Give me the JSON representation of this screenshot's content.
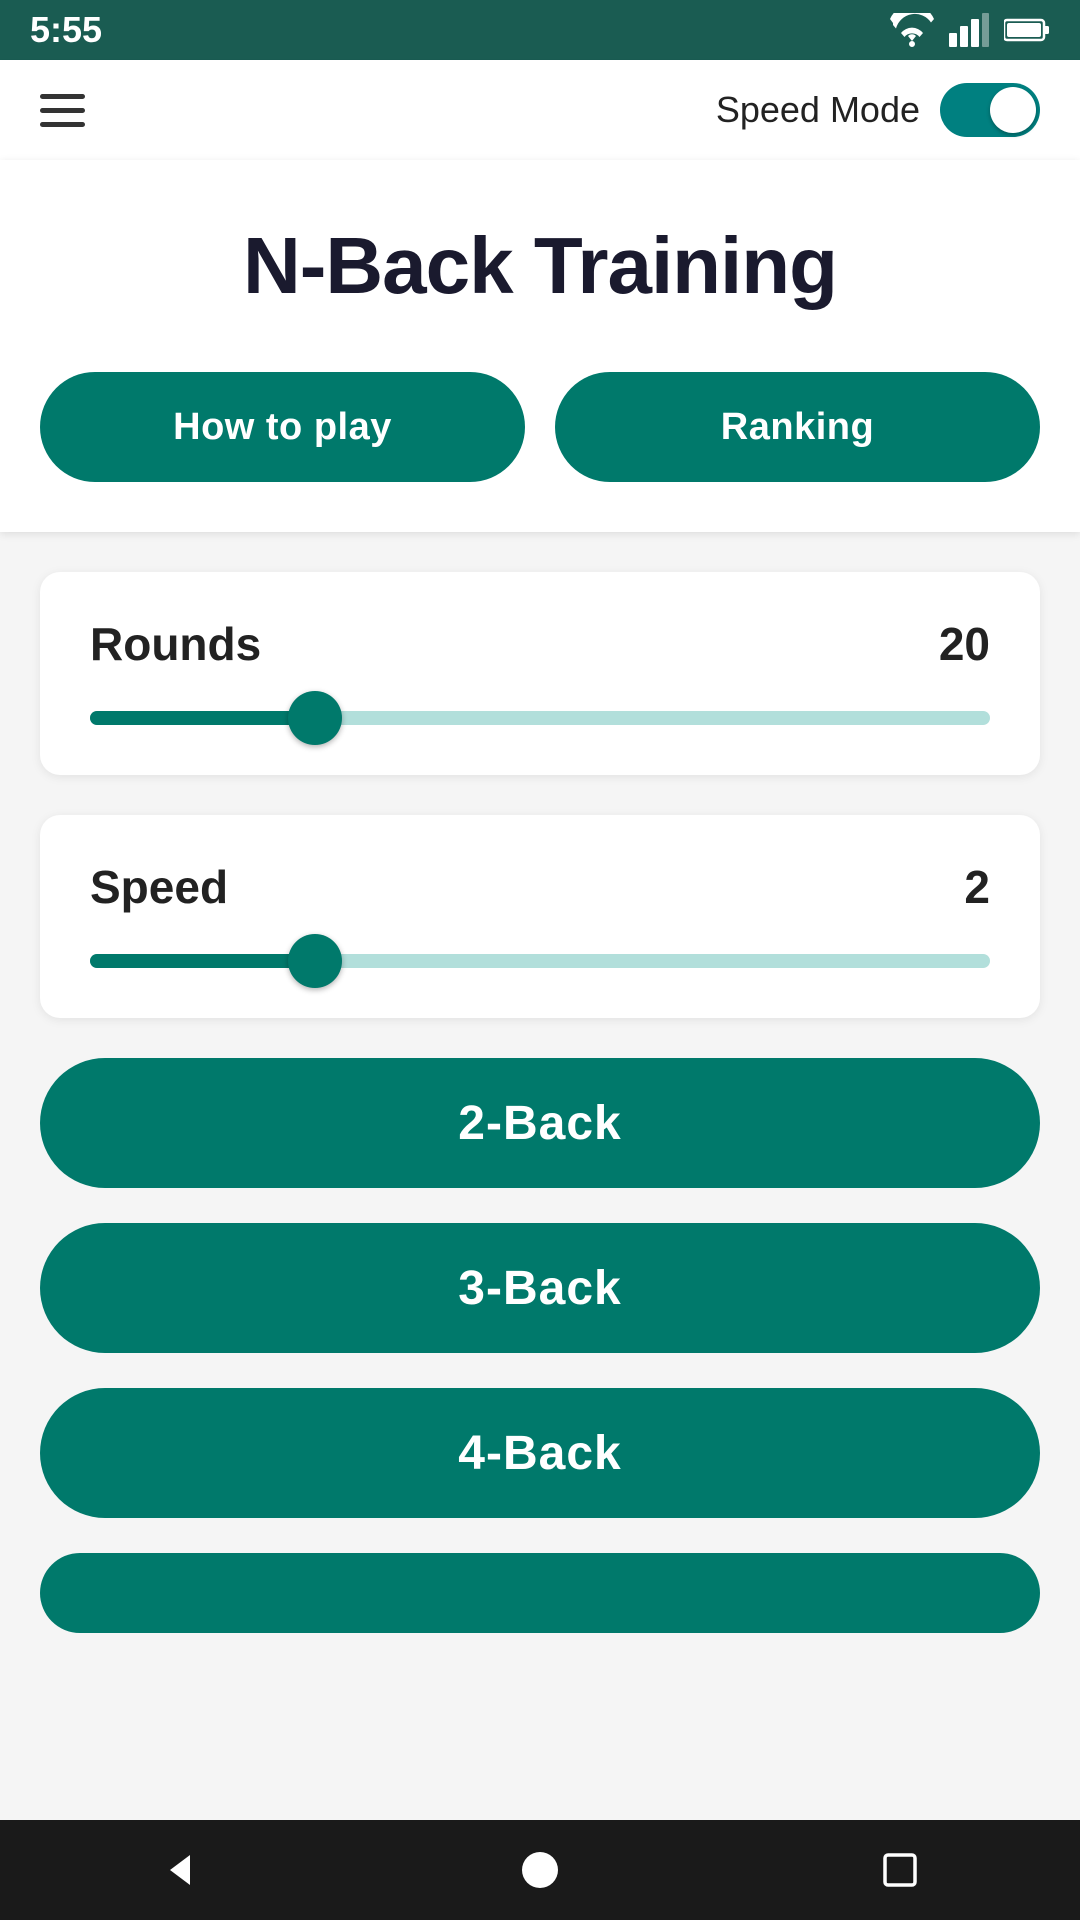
{
  "statusBar": {
    "time": "5:55"
  },
  "navBar": {
    "speedModeLabel": "Speed Mode"
  },
  "hero": {
    "title": "N-Back Training",
    "howToPlayLabel": "How to play",
    "rankingLabel": "Ranking"
  },
  "roundsSlider": {
    "label": "Rounds",
    "value": "20",
    "fillPercent": 25
  },
  "speedSlider": {
    "label": "Speed",
    "value": "2",
    "fillPercent": 25
  },
  "gameButtons": {
    "twoBack": "2-Back",
    "threeBack": "3-Back",
    "fourBack": "4-Back"
  }
}
